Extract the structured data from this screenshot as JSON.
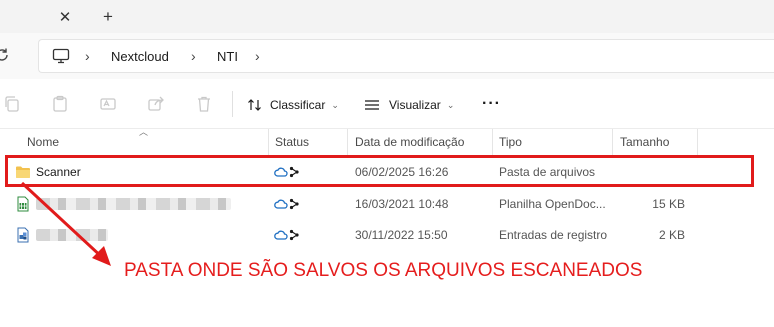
{
  "tabs": {
    "close_label": "✕",
    "new_label": "+"
  },
  "breadcrumb": {
    "items": [
      "Nextcloud",
      "NTI"
    ],
    "separator": "›"
  },
  "commandbar": {
    "sort_label": "Classificar",
    "view_label": "Visualizar",
    "more_label": "···"
  },
  "columns": {
    "name": "Nome",
    "status": "Status",
    "modified": "Data de modificação",
    "type": "Tipo",
    "size": "Tamanho"
  },
  "files": [
    {
      "name": "Scanner",
      "modified": "06/02/2025 16:26",
      "type": "Pasta de arquivos",
      "size": "",
      "icon": "folder-icon"
    },
    {
      "name": "",
      "modified": "16/03/2021 10:48",
      "type": "Planilha OpenDoc...",
      "size": "15 KB",
      "icon": "spreadsheet-icon"
    },
    {
      "name": "",
      "modified": "30/11/2022 15:50",
      "type": "Entradas de registro",
      "size": "2 KB",
      "icon": "registry-file-icon"
    }
  ],
  "annotation": {
    "text": "PASTA ONDE SÃO SALVOS OS ARQUIVOS ESCANEADOS",
    "color": "#e51d1d"
  },
  "colors": {
    "accent_cloud": "#1f6fc2",
    "folder": "#f2c14e",
    "highlight": "#e11b1b"
  }
}
